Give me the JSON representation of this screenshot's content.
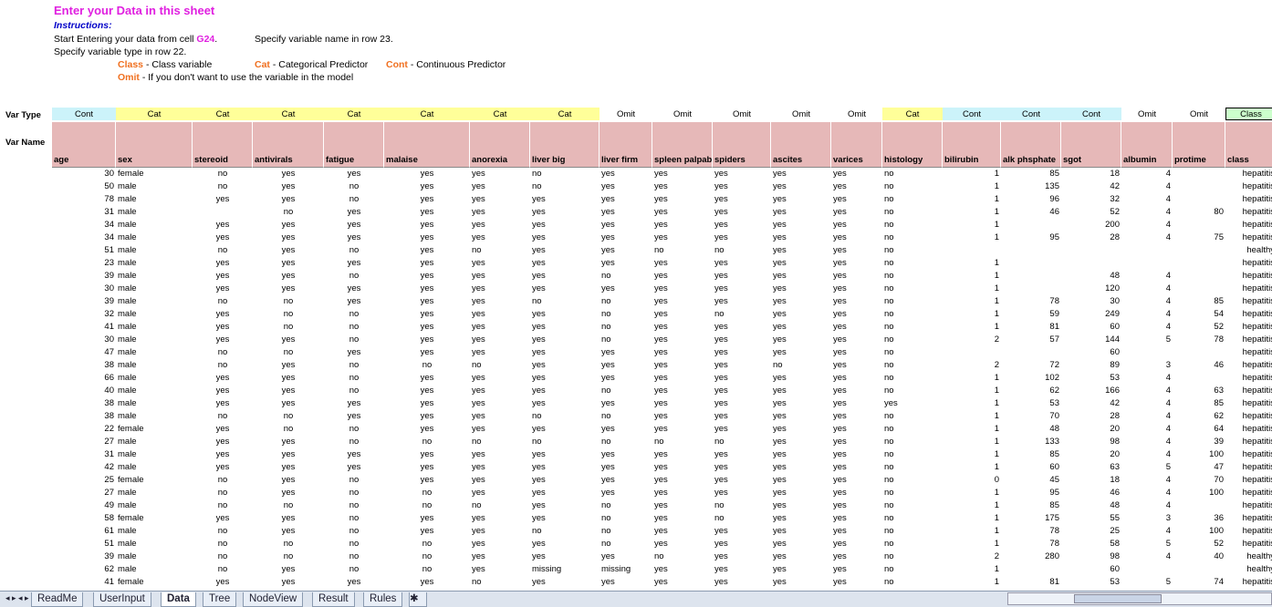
{
  "instructions": {
    "title": "Enter your Data in this sheet",
    "label": "Instructions:",
    "start_text": "Start Entering your data from cell ",
    "start_cell": "G24",
    "start_suffix": ".",
    "varname_text": "Specify variable name in row 23.",
    "vartype_text": "Specify variable type in row 22.",
    "class_key": "Class",
    "class_desc": " - Class variable",
    "cat_key": "Cat",
    "cat_desc": " - Categorical Predictor",
    "cont_key": "Cont",
    "cont_desc": " - Continuous Predictor",
    "omit_key": "Omit",
    "omit_desc": " - If you don't want to use the variable in the model"
  },
  "labels": {
    "var_type": "Var Type",
    "var_name": "Var Name"
  },
  "colors": {
    "cont": "#ccf3fa",
    "cat": "#ffff99",
    "omit": "#ffffff",
    "class": "#ccffcc",
    "name": "#e6b8b8"
  },
  "columns": [
    {
      "name": "age",
      "type": "Cont",
      "align": "num"
    },
    {
      "name": "sex",
      "type": "Cat",
      "align": "lft"
    },
    {
      "name": "stereoid",
      "type": "Cat",
      "align": "ctr"
    },
    {
      "name": "antivirals",
      "type": "Cat",
      "align": "ctr"
    },
    {
      "name": "fatigue",
      "type": "Cat",
      "align": "ctr"
    },
    {
      "name": "malaise",
      "type": "Cat",
      "align": "ctr"
    },
    {
      "name": "anorexia",
      "type": "Cat",
      "align": "lft"
    },
    {
      "name": "liver big",
      "type": "Cat",
      "align": "lft"
    },
    {
      "name": "liver firm",
      "type": "Omit",
      "align": "lft"
    },
    {
      "name": "spleen palpab",
      "type": "Omit",
      "align": "lft"
    },
    {
      "name": "spiders",
      "type": "Omit",
      "align": "lft"
    },
    {
      "name": "ascites",
      "type": "Omit",
      "align": "lft"
    },
    {
      "name": "varices",
      "type": "Omit",
      "align": "lft"
    },
    {
      "name": "histology",
      "type": "Cat",
      "align": "lft"
    },
    {
      "name": "bilirubin",
      "type": "Cont",
      "align": "num"
    },
    {
      "name": "alk phsphate",
      "type": "Cont",
      "align": "num"
    },
    {
      "name": "sgot",
      "type": "Cont",
      "align": "num"
    },
    {
      "name": "albumin",
      "type": "Omit",
      "align": "num"
    },
    {
      "name": "protime",
      "type": "Omit",
      "align": "num"
    },
    {
      "name": "class",
      "type": "Class",
      "align": "num"
    }
  ],
  "rows": [
    [
      "30",
      "female",
      "no",
      "yes",
      "yes",
      "yes",
      "yes",
      "no",
      "yes",
      "yes",
      "yes",
      "yes",
      "yes",
      "no",
      "1",
      "85",
      "18",
      "4",
      "",
      "hepatitis"
    ],
    [
      "50",
      "male",
      "no",
      "yes",
      "no",
      "yes",
      "yes",
      "no",
      "yes",
      "yes",
      "yes",
      "yes",
      "yes",
      "no",
      "1",
      "135",
      "42",
      "4",
      "",
      "hepatitis"
    ],
    [
      "78",
      "male",
      "yes",
      "yes",
      "no",
      "yes",
      "yes",
      "yes",
      "yes",
      "yes",
      "yes",
      "yes",
      "yes",
      "no",
      "1",
      "96",
      "32",
      "4",
      "",
      "hepatitis"
    ],
    [
      "31",
      "male",
      "",
      "no",
      "yes",
      "yes",
      "yes",
      "yes",
      "yes",
      "yes",
      "yes",
      "yes",
      "yes",
      "no",
      "1",
      "46",
      "52",
      "4",
      "80",
      "hepatitis"
    ],
    [
      "34",
      "male",
      "yes",
      "yes",
      "yes",
      "yes",
      "yes",
      "yes",
      "yes",
      "yes",
      "yes",
      "yes",
      "yes",
      "no",
      "1",
      "",
      "200",
      "4",
      "",
      "hepatitis"
    ],
    [
      "34",
      "male",
      "yes",
      "yes",
      "yes",
      "yes",
      "yes",
      "yes",
      "yes",
      "yes",
      "yes",
      "yes",
      "yes",
      "no",
      "1",
      "95",
      "28",
      "4",
      "75",
      "hepatitis"
    ],
    [
      "51",
      "male",
      "no",
      "yes",
      "no",
      "yes",
      "no",
      "yes",
      "yes",
      "no",
      "no",
      "yes",
      "yes",
      "no",
      "",
      "",
      "",
      "",
      "",
      "healthy"
    ],
    [
      "23",
      "male",
      "yes",
      "yes",
      "yes",
      "yes",
      "yes",
      "yes",
      "yes",
      "yes",
      "yes",
      "yes",
      "yes",
      "no",
      "1",
      "",
      "",
      "",
      "",
      "hepatitis"
    ],
    [
      "39",
      "male",
      "yes",
      "yes",
      "no",
      "yes",
      "yes",
      "yes",
      "no",
      "yes",
      "yes",
      "yes",
      "yes",
      "no",
      "1",
      "",
      "48",
      "4",
      "",
      "hepatitis"
    ],
    [
      "30",
      "male",
      "yes",
      "yes",
      "yes",
      "yes",
      "yes",
      "yes",
      "yes",
      "yes",
      "yes",
      "yes",
      "yes",
      "no",
      "1",
      "",
      "120",
      "4",
      "",
      "hepatitis"
    ],
    [
      "39",
      "male",
      "no",
      "no",
      "yes",
      "yes",
      "yes",
      "no",
      "no",
      "yes",
      "yes",
      "yes",
      "yes",
      "no",
      "1",
      "78",
      "30",
      "4",
      "85",
      "hepatitis"
    ],
    [
      "32",
      "male",
      "yes",
      "no",
      "no",
      "yes",
      "yes",
      "yes",
      "no",
      "yes",
      "no",
      "yes",
      "yes",
      "no",
      "1",
      "59",
      "249",
      "4",
      "54",
      "hepatitis"
    ],
    [
      "41",
      "male",
      "yes",
      "no",
      "no",
      "yes",
      "yes",
      "yes",
      "no",
      "yes",
      "yes",
      "yes",
      "yes",
      "no",
      "1",
      "81",
      "60",
      "4",
      "52",
      "hepatitis"
    ],
    [
      "30",
      "male",
      "yes",
      "yes",
      "no",
      "yes",
      "yes",
      "yes",
      "no",
      "yes",
      "yes",
      "yes",
      "yes",
      "no",
      "2",
      "57",
      "144",
      "5",
      "78",
      "hepatitis"
    ],
    [
      "47",
      "male",
      "no",
      "no",
      "yes",
      "yes",
      "yes",
      "yes",
      "yes",
      "yes",
      "yes",
      "yes",
      "yes",
      "no",
      "",
      "",
      "60",
      "",
      "",
      "hepatitis"
    ],
    [
      "38",
      "male",
      "no",
      "yes",
      "no",
      "no",
      "no",
      "yes",
      "yes",
      "yes",
      "yes",
      "no",
      "yes",
      "no",
      "2",
      "72",
      "89",
      "3",
      "46",
      "hepatitis"
    ],
    [
      "66",
      "male",
      "yes",
      "yes",
      "no",
      "yes",
      "yes",
      "yes",
      "yes",
      "yes",
      "yes",
      "yes",
      "yes",
      "no",
      "1",
      "102",
      "53",
      "4",
      "",
      "hepatitis"
    ],
    [
      "40",
      "male",
      "yes",
      "yes",
      "no",
      "yes",
      "yes",
      "yes",
      "no",
      "yes",
      "yes",
      "yes",
      "yes",
      "no",
      "1",
      "62",
      "166",
      "4",
      "63",
      "hepatitis"
    ],
    [
      "38",
      "male",
      "yes",
      "yes",
      "yes",
      "yes",
      "yes",
      "yes",
      "yes",
      "yes",
      "yes",
      "yes",
      "yes",
      "yes",
      "1",
      "53",
      "42",
      "4",
      "85",
      "hepatitis"
    ],
    [
      "38",
      "male",
      "no",
      "no",
      "yes",
      "yes",
      "yes",
      "no",
      "no",
      "yes",
      "yes",
      "yes",
      "yes",
      "no",
      "1",
      "70",
      "28",
      "4",
      "62",
      "hepatitis"
    ],
    [
      "22",
      "female",
      "yes",
      "no",
      "no",
      "yes",
      "yes",
      "yes",
      "yes",
      "yes",
      "yes",
      "yes",
      "yes",
      "no",
      "1",
      "48",
      "20",
      "4",
      "64",
      "hepatitis"
    ],
    [
      "27",
      "male",
      "yes",
      "yes",
      "no",
      "no",
      "no",
      "no",
      "no",
      "no",
      "no",
      "yes",
      "yes",
      "no",
      "1",
      "133",
      "98",
      "4",
      "39",
      "hepatitis"
    ],
    [
      "31",
      "male",
      "yes",
      "yes",
      "yes",
      "yes",
      "yes",
      "yes",
      "yes",
      "yes",
      "yes",
      "yes",
      "yes",
      "no",
      "1",
      "85",
      "20",
      "4",
      "100",
      "hepatitis"
    ],
    [
      "42",
      "male",
      "yes",
      "yes",
      "yes",
      "yes",
      "yes",
      "yes",
      "yes",
      "yes",
      "yes",
      "yes",
      "yes",
      "no",
      "1",
      "60",
      "63",
      "5",
      "47",
      "hepatitis"
    ],
    [
      "25",
      "female",
      "no",
      "yes",
      "no",
      "yes",
      "yes",
      "yes",
      "yes",
      "yes",
      "yes",
      "yes",
      "yes",
      "no",
      "0",
      "45",
      "18",
      "4",
      "70",
      "hepatitis"
    ],
    [
      "27",
      "male",
      "no",
      "yes",
      "no",
      "no",
      "yes",
      "yes",
      "yes",
      "yes",
      "yes",
      "yes",
      "yes",
      "no",
      "1",
      "95",
      "46",
      "4",
      "100",
      "hepatitis"
    ],
    [
      "49",
      "male",
      "no",
      "no",
      "no",
      "no",
      "no",
      "yes",
      "no",
      "yes",
      "no",
      "yes",
      "yes",
      "no",
      "1",
      "85",
      "48",
      "4",
      "",
      "hepatitis"
    ],
    [
      "58",
      "female",
      "yes",
      "yes",
      "no",
      "yes",
      "yes",
      "yes",
      "no",
      "yes",
      "no",
      "yes",
      "yes",
      "no",
      "1",
      "175",
      "55",
      "3",
      "36",
      "hepatitis"
    ],
    [
      "61",
      "male",
      "no",
      "yes",
      "no",
      "yes",
      "yes",
      "no",
      "no",
      "yes",
      "yes",
      "yes",
      "yes",
      "no",
      "1",
      "78",
      "25",
      "4",
      "100",
      "hepatitis"
    ],
    [
      "51",
      "male",
      "no",
      "no",
      "no",
      "no",
      "yes",
      "yes",
      "no",
      "yes",
      "yes",
      "yes",
      "yes",
      "no",
      "1",
      "78",
      "58",
      "5",
      "52",
      "hepatitis"
    ],
    [
      "39",
      "male",
      "no",
      "no",
      "no",
      "no",
      "yes",
      "yes",
      "yes",
      "no",
      "yes",
      "yes",
      "yes",
      "no",
      "2",
      "280",
      "98",
      "4",
      "40",
      "healthy"
    ],
    [
      "62",
      "male",
      "no",
      "yes",
      "no",
      "no",
      "yes",
      "missing",
      "missing",
      "yes",
      "yes",
      "yes",
      "yes",
      "no",
      "1",
      "",
      "60",
      "",
      "",
      "healthy"
    ],
    [
      "41",
      "female",
      "yes",
      "yes",
      "yes",
      "yes",
      "no",
      "yes",
      "yes",
      "yes",
      "yes",
      "yes",
      "yes",
      "no",
      "1",
      "81",
      "53",
      "5",
      "74",
      "hepatitis"
    ]
  ],
  "tabs": [
    "ReadMe",
    "UserInput",
    "Data",
    "Tree",
    "NodeView",
    "Result",
    "Rules"
  ],
  "active_tab": "Data",
  "nav_arrows": "◂ ▸ ◂ ▸"
}
